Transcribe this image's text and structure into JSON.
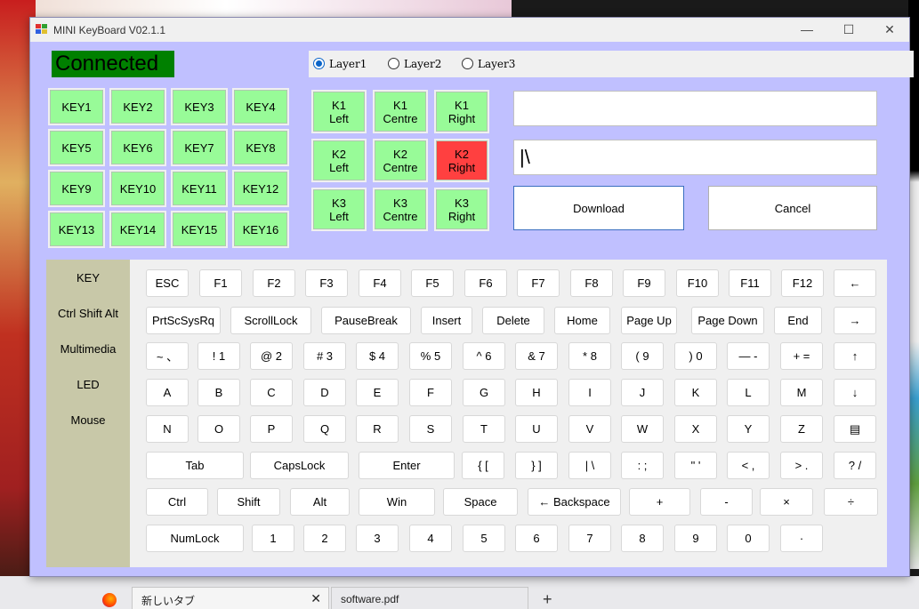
{
  "window": {
    "title": "MINI KeyBoard V02.1.1",
    "minimize": "—",
    "maximize": "☐",
    "close": "✕"
  },
  "status": "Connected",
  "layers": [
    {
      "label": "Layer1",
      "selected": true
    },
    {
      "label": "Layer2",
      "selected": false
    },
    {
      "label": "Layer3",
      "selected": false
    }
  ],
  "key_buttons": [
    "KEY1",
    "KEY2",
    "KEY3",
    "KEY4",
    "KEY5",
    "KEY6",
    "KEY7",
    "KEY8",
    "KEY9",
    "KEY10",
    "KEY11",
    "KEY12",
    "KEY13",
    "KEY14",
    "KEY15",
    "KEY16"
  ],
  "knob_buttons": [
    {
      "line1": "K1",
      "line2": "Left"
    },
    {
      "line1": "K1",
      "line2": "Centre"
    },
    {
      "line1": "K1",
      "line2": "Right"
    },
    {
      "line1": "K2",
      "line2": "Left"
    },
    {
      "line1": "K2",
      "line2": "Centre"
    },
    {
      "line1": "K2",
      "line2": "Right"
    },
    {
      "line1": "K3",
      "line2": "Left"
    },
    {
      "line1": "K3",
      "line2": "Centre"
    },
    {
      "line1": "K3",
      "line2": "Right"
    }
  ],
  "colors": {
    "key_green": "#98fb98",
    "key_selected_red": "#ff4040",
    "window_bg": "#c0c0ff",
    "status_bg": "#008000"
  },
  "text_inputs": {
    "top_value": "",
    "bottom_value": "|\\"
  },
  "actions": {
    "download": "Download",
    "cancel": "Cancel"
  },
  "sidebar": [
    "KEY",
    "Ctrl Shift Alt",
    "Multimedia",
    "LED",
    "Mouse"
  ],
  "keyboard_rows": [
    [
      "ESC",
      "F1",
      "F2",
      "F3",
      "F4",
      "F5",
      "F6",
      "F7",
      "F8",
      "F9",
      "F10",
      "F11",
      "F12",
      "←"
    ],
    [
      "PrtScSysRq",
      "ScrollLock",
      "PauseBreak",
      "Insert",
      "Delete",
      "Home",
      "Page Up",
      "Page Down",
      "End",
      "→"
    ],
    [
      "~ 、",
      "! 1",
      "@ 2",
      "# 3",
      "$ 4",
      "% 5",
      "^ 6",
      "& 7",
      "* 8",
      "( 9",
      ") 0",
      "— -",
      "+ =",
      "↑"
    ],
    [
      "A",
      "B",
      "C",
      "D",
      "E",
      "F",
      "G",
      "H",
      "I",
      "J",
      "K",
      "L",
      "M",
      "↓"
    ],
    [
      "N",
      "O",
      "P",
      "Q",
      "R",
      "S",
      "T",
      "U",
      "V",
      "W",
      "X",
      "Y",
      "Z",
      "▤"
    ],
    [
      "Tab",
      "CapsLock",
      "Enter",
      "{ [",
      "} ]",
      "| \\",
      ": ;",
      "\" '",
      "< ,",
      "> .",
      "? /"
    ],
    [
      "Ctrl",
      "Shift",
      "Alt",
      "Win",
      "Space",
      "← Backspace",
      "+",
      "-",
      "×",
      "÷"
    ],
    [
      "NumLock",
      "1",
      "2",
      "3",
      "4",
      "5",
      "6",
      "7",
      "8",
      "9",
      "0",
      "·"
    ]
  ],
  "taskbar": {
    "tab1": "新しいタブ",
    "tab2": "software.pdf",
    "close": "✕",
    "new_tab": "+"
  }
}
